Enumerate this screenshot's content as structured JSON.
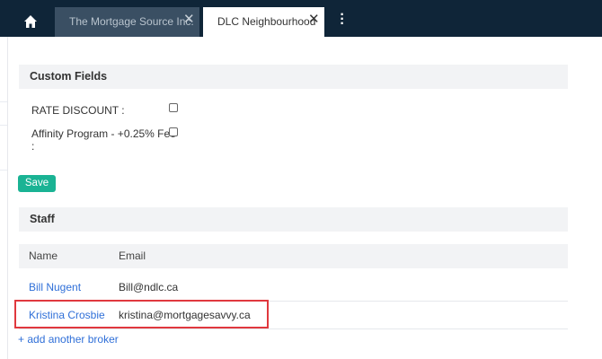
{
  "tabs": [
    {
      "label": "The Mortgage Source Inc.",
      "active": false
    },
    {
      "label": "DLC Neighbourhood",
      "active": true
    }
  ],
  "close_glyph": "✕",
  "custom_fields": {
    "title": "Custom Fields",
    "fields": [
      {
        "label": "RATE DISCOUNT :",
        "checked": false
      },
      {
        "label": "Affinity Program - +0.25% Fee",
        "label_suffix": ":",
        "checked": false
      }
    ],
    "save_label": "Save"
  },
  "staff": {
    "title": "Staff",
    "columns": [
      "Name",
      "Email"
    ],
    "rows": [
      {
        "name": "Bill Nugent",
        "email": "Bill@ndlc.ca"
      },
      {
        "name": "Kristina Crosbie",
        "email": "kristina@mortgagesavvy.ca"
      }
    ],
    "add_label": "+ add another broker"
  },
  "colors": {
    "topbar": "#0f2538",
    "accent": "#1ab394",
    "link": "#2f6fd8",
    "highlight": "#e0383e"
  }
}
